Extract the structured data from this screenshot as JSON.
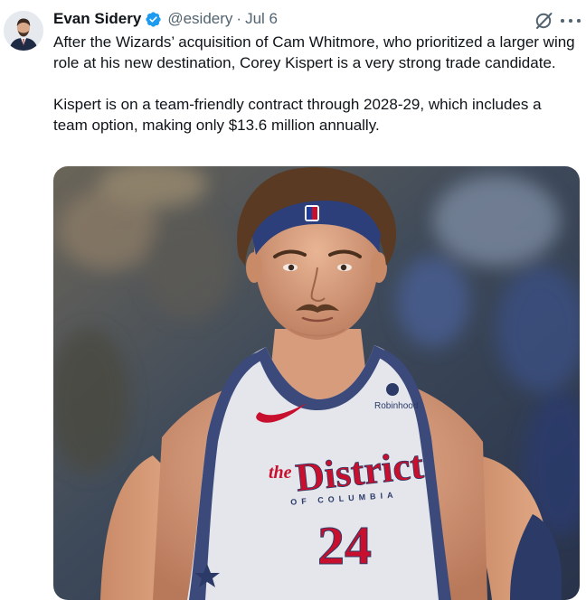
{
  "tweet": {
    "author_name": "Evan Sidery",
    "handle": "@esidery",
    "separator": "·",
    "date": "Jul 6",
    "paragraphs": [
      "After the Wizards’ acquisition of Cam Whitmore, who prioritized a larger wing role at his new destination, Corey Kispert is a very strong trade candidate.",
      "Kispert is on a team-friendly contract through 2028-29, which includes a team option, making only $13.6 million annually."
    ]
  },
  "media": {
    "description_icon": "photo",
    "jersey": {
      "top_word": "the",
      "wordmark": "District",
      "sub_wordmark": "OF COLUMBIA",
      "number": "24",
      "sponsor": "Robinhood"
    }
  },
  "colors": {
    "verified": "#1d9bf0",
    "secondary_text": "#536471",
    "jersey_red": "#c8102e",
    "jersey_navy": "#2b3a67"
  }
}
